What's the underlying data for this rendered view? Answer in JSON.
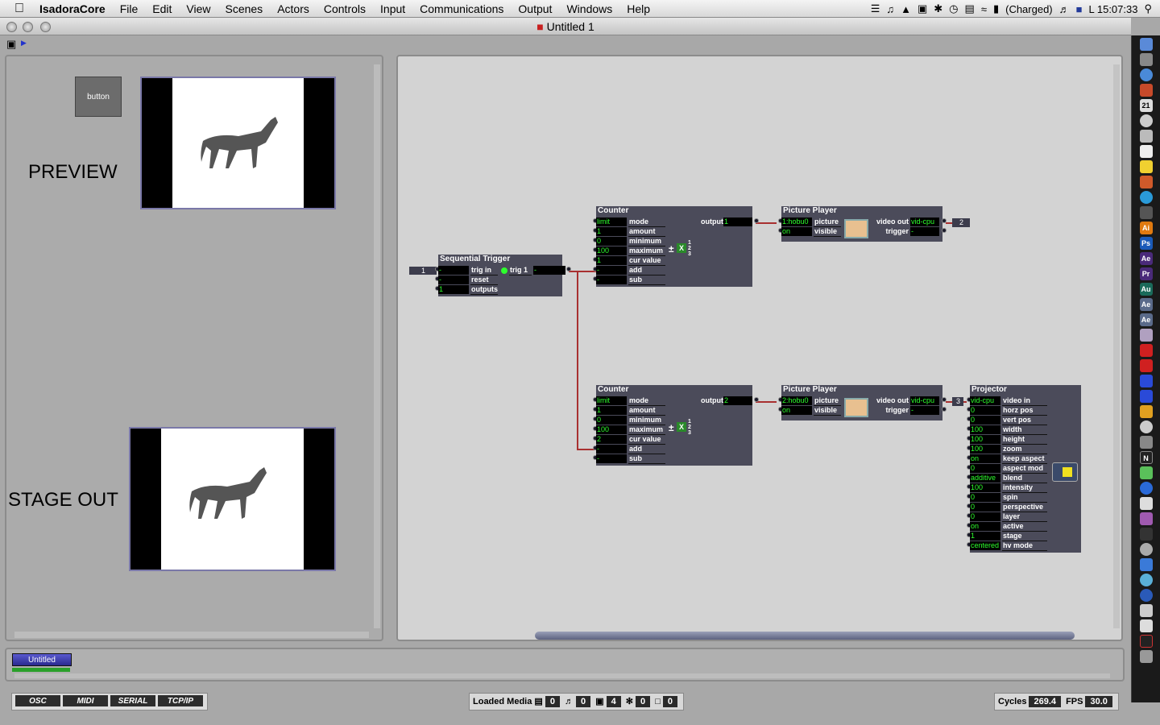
{
  "menubar": {
    "app": "IsadoraCore",
    "items": [
      "File",
      "Edit",
      "View",
      "Scenes",
      "Actors",
      "Controls",
      "Input",
      "Communications",
      "Output",
      "Windows",
      "Help"
    ],
    "battery": "(Charged)",
    "clock": "L 15:07:33"
  },
  "window": {
    "title": "Untitled 1"
  },
  "preview": {
    "button_label": "button",
    "preview_label": "PREVIEW",
    "stage_label": "STAGE OUT"
  },
  "seq": {
    "title": "Sequential Trigger",
    "inval": "1",
    "rows": [
      {
        "v": "-",
        "l": "trig in"
      },
      {
        "v": "-",
        "l": "reset"
      },
      {
        "v": "1",
        "l": "outputs"
      }
    ],
    "out_label": "trig 1",
    "out_val": "-"
  },
  "counter1": {
    "title": "Counter",
    "rows": [
      {
        "v": "limit",
        "l": "mode"
      },
      {
        "v": "1",
        "l": "amount"
      },
      {
        "v": "0",
        "l": "minimum"
      },
      {
        "v": "100",
        "l": "maximum"
      },
      {
        "v": "1",
        "l": "cur value"
      },
      {
        "v": "-",
        "l": "add"
      },
      {
        "v": "-",
        "l": "sub"
      }
    ],
    "out_label": "output",
    "out_val": "1"
  },
  "counter2": {
    "title": "Counter",
    "rows": [
      {
        "v": "limit",
        "l": "mode"
      },
      {
        "v": "1",
        "l": "amount"
      },
      {
        "v": "0",
        "l": "minimum"
      },
      {
        "v": "100",
        "l": "maximum"
      },
      {
        "v": "2",
        "l": "cur value"
      },
      {
        "v": "-",
        "l": "add"
      },
      {
        "v": "-",
        "l": "sub"
      }
    ],
    "out_label": "output",
    "out_val": "2"
  },
  "pp1": {
    "title": "Picture Player",
    "rows": [
      {
        "v": "1:hobu0",
        "l": "picture"
      },
      {
        "v": "on",
        "l": "visible"
      }
    ],
    "outs": [
      {
        "l": "video out",
        "v": "vid-cpu"
      },
      {
        "l": "trigger",
        "v": "-"
      }
    ],
    "badge": "2"
  },
  "pp2": {
    "title": "Picture Player",
    "rows": [
      {
        "v": "2:hobu0",
        "l": "picture"
      },
      {
        "v": "on",
        "l": "visible"
      }
    ],
    "outs": [
      {
        "l": "video out",
        "v": "vid-cpu"
      },
      {
        "l": "trigger",
        "v": "-"
      }
    ],
    "badge": "3"
  },
  "proj": {
    "title": "Projector",
    "rows": [
      {
        "v": "vid-cpu",
        "l": "video in"
      },
      {
        "v": "0",
        "l": "horz pos"
      },
      {
        "v": "0",
        "l": "vert pos"
      },
      {
        "v": "100",
        "l": "width"
      },
      {
        "v": "100",
        "l": "height"
      },
      {
        "v": "100",
        "l": "zoom"
      },
      {
        "v": "on",
        "l": "keep aspect"
      },
      {
        "v": "0",
        "l": "aspect mod"
      },
      {
        "v": "additive",
        "l": "blend"
      },
      {
        "v": "100",
        "l": "intensity"
      },
      {
        "v": "0",
        "l": "spin"
      },
      {
        "v": "0",
        "l": "perspective"
      },
      {
        "v": "0",
        "l": "layer"
      },
      {
        "v": "on",
        "l": "active"
      },
      {
        "v": "1",
        "l": "stage"
      },
      {
        "v": "centered",
        "l": "hv mode"
      }
    ]
  },
  "scene": {
    "name": "Untitled"
  },
  "tabs": [
    "OSC",
    "MIDI",
    "SERIAL",
    "TCP/IP"
  ],
  "media": {
    "label": "Loaded Media",
    "counts": [
      "0",
      "0",
      "4",
      "0",
      "0"
    ]
  },
  "perf": {
    "cycles_label": "Cycles",
    "cycles": "269.4",
    "fps_label": "FPS",
    "fps": "30.0"
  }
}
